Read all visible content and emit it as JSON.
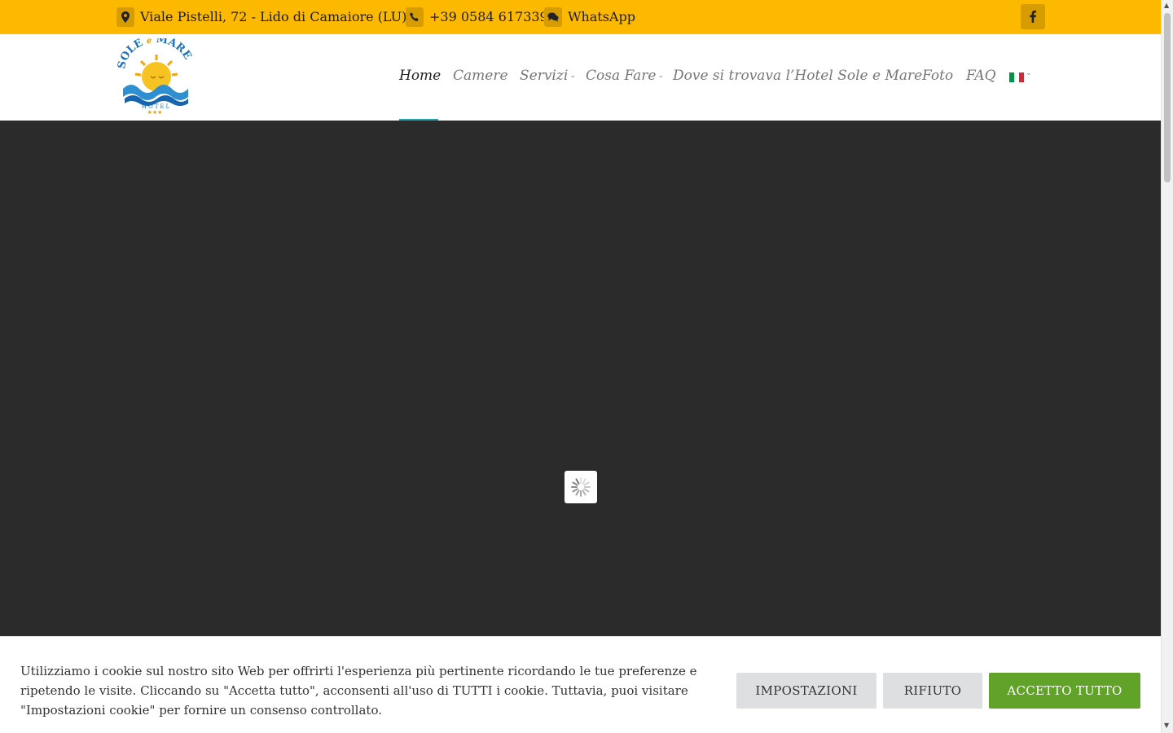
{
  "topbar": {
    "address": "Viale Pistelli, 72 - Lido di Camaiore (LU)",
    "phone": "+39 0584 617339",
    "whatsapp": "WhatsApp",
    "address_icon": "map-marker-icon",
    "phone_icon": "phone-icon",
    "whatsapp_icon": "chat-icon",
    "facebook_icon": "facebook-icon",
    "bg_color": "#fdb900",
    "icon_bg_color": "#d79d00"
  },
  "logo": {
    "word1": "SOLE",
    "word2": "e",
    "word3": "MARE",
    "subtitle": "HOTEL",
    "stars": "★★★"
  },
  "nav": {
    "items": [
      {
        "label": "Home",
        "active": true
      },
      {
        "label": "Camere"
      },
      {
        "label": "Servizi",
        "dropdown": true
      },
      {
        "label": "Cosa Fare",
        "dropdown": true
      },
      {
        "label": "Dove si trovava l’Hotel Sole e Mare"
      },
      {
        "label": "Foto"
      },
      {
        "label": "FAQ"
      }
    ],
    "language": "it",
    "active_color": "#25a5b0"
  },
  "hero": {
    "bg_color": "#2b2b2b",
    "loader_icon": "spinner-icon"
  },
  "cookie": {
    "text": "Utilizziamo i cookie sul nostro sito Web per offrirti l'esperienza più pertinente ricordando le tue preferenze e ripetendo le visite. Cliccando su \"Accetta tutto\", acconsenti all'uso di TUTTI i cookie. Tuttavia, puoi visitare \"Impostazioni cookie\" per fornire un consenso controllato.",
    "settings_label": "IMPOSTAZIONI",
    "reject_label": "RIFIUTO",
    "accept_label": "ACCETTO TUTTO",
    "accept_color": "#61a229"
  }
}
